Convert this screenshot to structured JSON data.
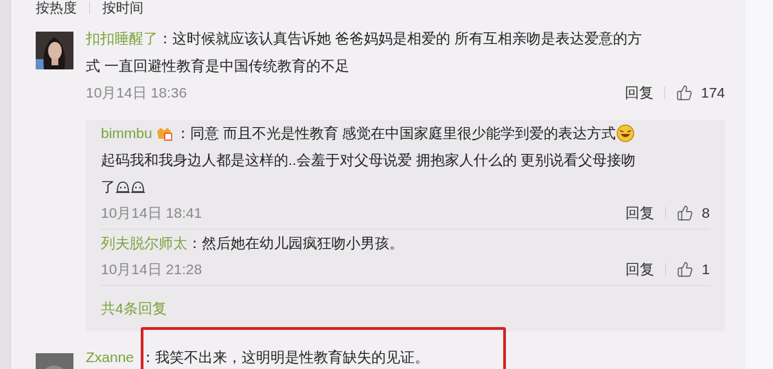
{
  "sort_tabs": [
    {
      "label": "按热度"
    },
    {
      "label": "按时间"
    }
  ],
  "comment": {
    "user": "扣扣睡醒了",
    "lines": [
      {
        "text": "：这时候就应该认真告诉她 爸爸妈妈是相爱的 所有互相亲吻是表达爱意的方"
      },
      {
        "text": "式 一直回避性教育是中国传统教育的不足"
      }
    ],
    "time": "10月14日 18:36",
    "reply_label": "回复",
    "likes": "174",
    "replies": [
      {
        "user": "bimmbu",
        "badge": true,
        "lines": [
          {
            "text": "：同意 而且不光是性教育 感觉在中国家庭里很少能学到爱的表达方式",
            "emojis": [
              {
                "kind": "laughing"
              }
            ]
          },
          {
            "text": "起码我和我身边人都是这样的..会羞于对父母说爱 拥抱家人什么的 更别说看父母接吻"
          },
          {
            "text": "了",
            "emojis": [
              {
                "kind": "blank"
              },
              {
                "kind": "blank"
              }
            ]
          }
        ],
        "time": "10月14日 18:41",
        "reply_label": "回复",
        "likes": "8"
      },
      {
        "user": "列夫脱尔师太",
        "badge": false,
        "lines": [
          {
            "text": "：然后她在幼儿园疯狂吻小男孩。"
          }
        ],
        "time": "10月14日 21:28",
        "reply_label": "回复",
        "likes": "1"
      }
    ],
    "more_replies": "共4条回复"
  },
  "next_comment": {
    "user": "Zxanne",
    "text": "：我笑不出来，这明明是性教育缺失的见证。",
    "highlighted": true
  }
}
